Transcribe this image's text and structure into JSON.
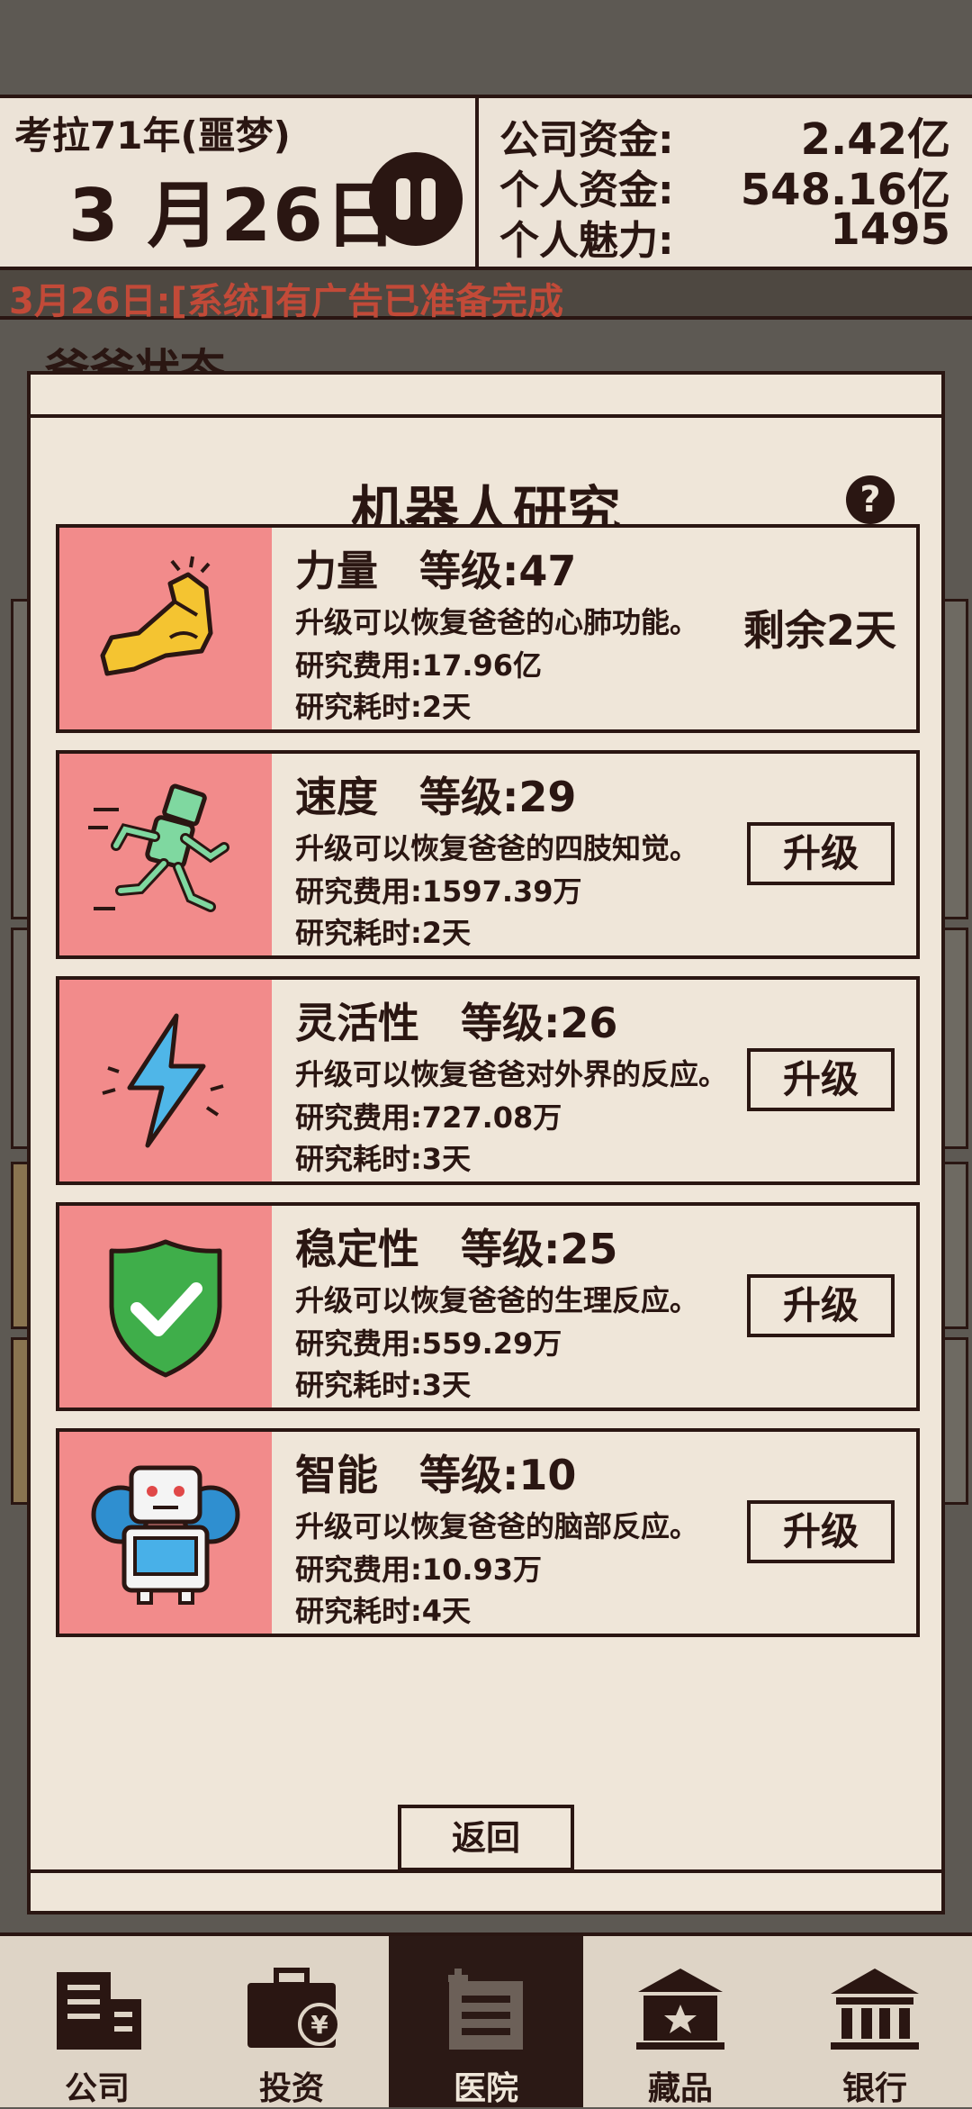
{
  "header": {
    "era": "考拉71年(噩梦)",
    "date": "3 月26日",
    "stats": [
      {
        "label": "公司资金:",
        "value": "2.42亿"
      },
      {
        "label": "个人资金:",
        "value": "548.16亿"
      },
      {
        "label": "个人魅力:",
        "value": "1495"
      }
    ]
  },
  "ticker": {
    "message": "3月26日:[系统]有广告已准备完成"
  },
  "background": {
    "section_title": "爸爸状态"
  },
  "modal": {
    "title": "机器人研究",
    "help_glyph": "?",
    "items": [
      {
        "name": "力量　等级:47",
        "desc": "升级可以恢复爸爸的心肺功能。",
        "cost": "研究费用:17.96亿",
        "time": "研究耗时:2天",
        "status": "剩余2天",
        "icon": "muscle-arm-icon"
      },
      {
        "name": "速度　等级:29",
        "desc": "升级可以恢复爸爸的四肢知觉。",
        "cost": "研究费用:1597.39万",
        "time": "研究耗时:2天",
        "button": "升级",
        "icon": "running-robot-icon"
      },
      {
        "name": "灵活性　等级:26",
        "desc": "升级可以恢复爸爸对外界的反应。",
        "cost": "研究费用:727.08万",
        "time": "研究耗时:3天",
        "button": "升级",
        "icon": "lightning-bolt-icon"
      },
      {
        "name": "稳定性　等级:25",
        "desc": "升级可以恢复爸爸的生理反应。",
        "cost": "研究费用:559.29万",
        "time": "研究耗时:3天",
        "button": "升级",
        "icon": "shield-check-icon"
      },
      {
        "name": "智能　等级:10",
        "desc": "升级可以恢复爸爸的脑部反应。",
        "cost": "研究费用:10.93万",
        "time": "研究耗时:4天",
        "button": "升级",
        "icon": "robot-gear-icon"
      }
    ],
    "back_label": "返回"
  },
  "nav": {
    "items": [
      {
        "label": "公司",
        "icon": "company-building-icon",
        "active": false
      },
      {
        "label": "投资",
        "icon": "briefcase-yen-icon",
        "active": false
      },
      {
        "label": "医院",
        "icon": "hospital-icon",
        "active": true
      },
      {
        "label": "藏品",
        "icon": "museum-star-icon",
        "active": false
      },
      {
        "label": "银行",
        "icon": "bank-icon",
        "active": false
      }
    ]
  },
  "colors": {
    "ink": "#2a1612",
    "paper": "#efe6d9",
    "icon_bg": "#f28b8b",
    "ticker_text": "#c24a38"
  }
}
